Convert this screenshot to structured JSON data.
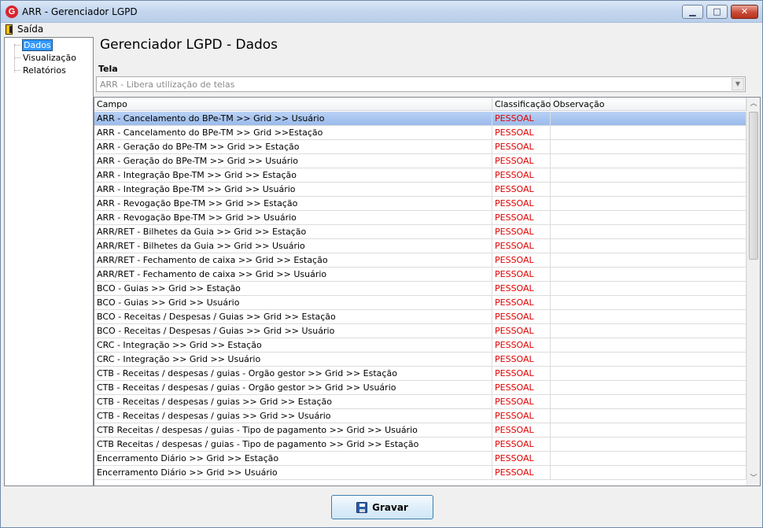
{
  "window": {
    "title": "ARR - Gerenciador LGPD",
    "app_icon_letter": "G",
    "min_glyph": "▁",
    "max_glyph": "□",
    "close_glyph": "✕"
  },
  "menu": {
    "exit_label": "Saída"
  },
  "tree": {
    "items": [
      {
        "label": "Dados",
        "selected": true
      },
      {
        "label": "Visualização",
        "selected": false
      },
      {
        "label": "Relatórios",
        "selected": false
      }
    ]
  },
  "main": {
    "page_title": "Gerenciador LGPD - Dados",
    "tela_label": "Tela",
    "tela_value": "ARR - Libera utilização de telas",
    "combo_arrow": "▼"
  },
  "grid": {
    "headers": [
      "Campo",
      "Classificação",
      "Observação"
    ],
    "rows": [
      {
        "campo": "ARR - Cancelamento do BPe-TM >> Grid >> Usuário",
        "classificacao": "PESSOAL",
        "observacao": ""
      },
      {
        "campo": "ARR - Cancelamento do BPe-TM >> Grid >>Estação",
        "classificacao": "PESSOAL",
        "observacao": ""
      },
      {
        "campo": "ARR - Geração do BPe-TM >> Grid >> Estação",
        "classificacao": "PESSOAL",
        "observacao": ""
      },
      {
        "campo": "ARR - Geração do BPe-TM >> Grid >> Usuário",
        "classificacao": "PESSOAL",
        "observacao": ""
      },
      {
        "campo": "ARR - Integração Bpe-TM >> Grid >> Estação",
        "classificacao": "PESSOAL",
        "observacao": ""
      },
      {
        "campo": "ARR - Integração Bpe-TM >> Grid >> Usuário",
        "classificacao": "PESSOAL",
        "observacao": ""
      },
      {
        "campo": "ARR - Revogação Bpe-TM >> Grid >> Estação",
        "classificacao": "PESSOAL",
        "observacao": ""
      },
      {
        "campo": "ARR - Revogação Bpe-TM >> Grid >> Usuário",
        "classificacao": "PESSOAL",
        "observacao": ""
      },
      {
        "campo": "ARR/RET - Bilhetes da Guia >> Grid >> Estação",
        "classificacao": "PESSOAL",
        "observacao": ""
      },
      {
        "campo": "ARR/RET - Bilhetes da Guia >> Grid >> Usuário",
        "classificacao": "PESSOAL",
        "observacao": ""
      },
      {
        "campo": "ARR/RET - Fechamento de caixa >> Grid >> Estação",
        "classificacao": "PESSOAL",
        "observacao": ""
      },
      {
        "campo": "ARR/RET - Fechamento de caixa >> Grid >> Usuário",
        "classificacao": "PESSOAL",
        "observacao": ""
      },
      {
        "campo": "BCO - Guias >> Grid >> Estação",
        "classificacao": "PESSOAL",
        "observacao": ""
      },
      {
        "campo": "BCO - Guias >> Grid >> Usuário",
        "classificacao": "PESSOAL",
        "observacao": ""
      },
      {
        "campo": "BCO - Receitas / Despesas / Guias >> Grid >> Estação",
        "classificacao": "PESSOAL",
        "observacao": ""
      },
      {
        "campo": "BCO - Receitas / Despesas / Guias >> Grid >> Usuário",
        "classificacao": "PESSOAL",
        "observacao": ""
      },
      {
        "campo": "CRC - Integração >> Grid >> Estação",
        "classificacao": "PESSOAL",
        "observacao": ""
      },
      {
        "campo": "CRC - Integração >> Grid >> Usuário",
        "classificacao": "PESSOAL",
        "observacao": ""
      },
      {
        "campo": "CTB - Receitas / despesas / guias - Orgão gestor >> Grid >> Estação",
        "classificacao": "PESSOAL",
        "observacao": ""
      },
      {
        "campo": "CTB - Receitas / despesas / guias - Orgão gestor >> Grid >> Usuário",
        "classificacao": "PESSOAL",
        "observacao": ""
      },
      {
        "campo": "CTB - Receitas / despesas / guias >> Grid >> Estação",
        "classificacao": "PESSOAL",
        "observacao": ""
      },
      {
        "campo": "CTB - Receitas / despesas / guias >> Grid >> Usuário",
        "classificacao": "PESSOAL",
        "observacao": ""
      },
      {
        "campo": "CTB Receitas / despesas / guias - Tipo de pagamento >> Grid >>  Usuário",
        "classificacao": "PESSOAL",
        "observacao": ""
      },
      {
        "campo": "CTB Receitas / despesas / guias - Tipo de pagamento >> Grid >> Estação",
        "classificacao": "PESSOAL",
        "observacao": ""
      },
      {
        "campo": "Encerramento Diário >> Grid >> Estação",
        "classificacao": "PESSOAL",
        "observacao": ""
      },
      {
        "campo": "Encerramento Diário >> Grid >> Usuário",
        "classificacao": "PESSOAL",
        "observacao": ""
      }
    ],
    "selected_row": 0,
    "scroll_up_glyph": "︿",
    "scroll_down_glyph": "﹀"
  },
  "footer": {
    "save_label": "Gravar"
  },
  "colors": {
    "classification_text": "#e00000",
    "selected_row": "#9bbbeb"
  }
}
